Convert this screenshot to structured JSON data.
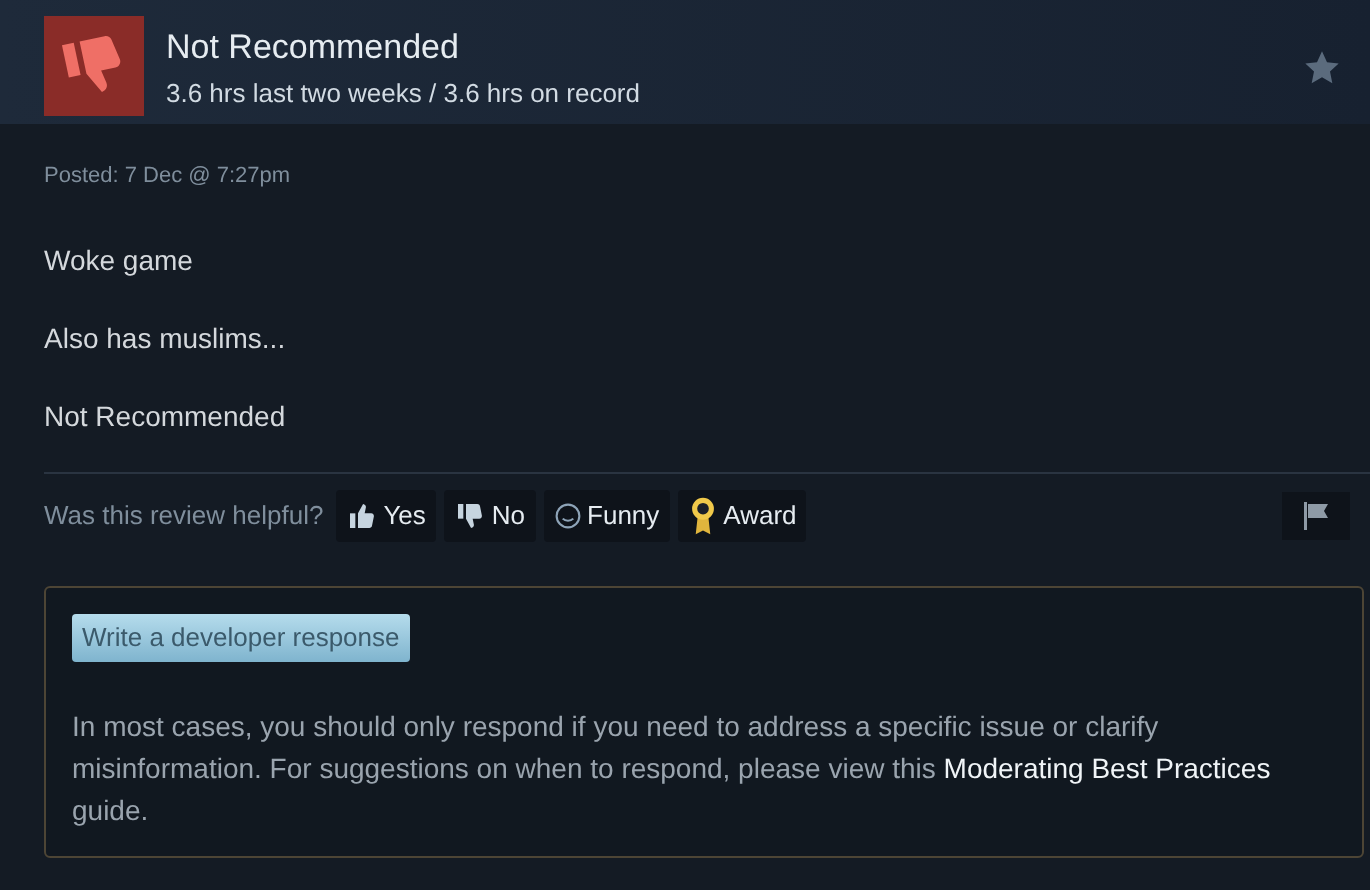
{
  "review": {
    "verdict": "Not Recommended",
    "hours": "3.6 hrs last two weeks / 3.6 hrs on record",
    "posted": "Posted: 7 Dec @ 7:27pm",
    "paragraphs": [
      "Woke game",
      "Also has muslims...",
      "Not Recommended"
    ]
  },
  "helpful": {
    "prompt": "Was this review helpful?",
    "buttons": [
      {
        "kind": "yes",
        "label": "Yes"
      },
      {
        "kind": "no",
        "label": "No"
      },
      {
        "kind": "funny",
        "label": "Funny"
      },
      {
        "kind": "award",
        "label": "Award"
      }
    ]
  },
  "developer_response": {
    "button": "Write a developer response",
    "note": "In most cases, you should only respond if you need to address a specific issue or clarify misinformation. For suggestions on when to respond, please view this **Moderating Best Practices** guide."
  }
}
